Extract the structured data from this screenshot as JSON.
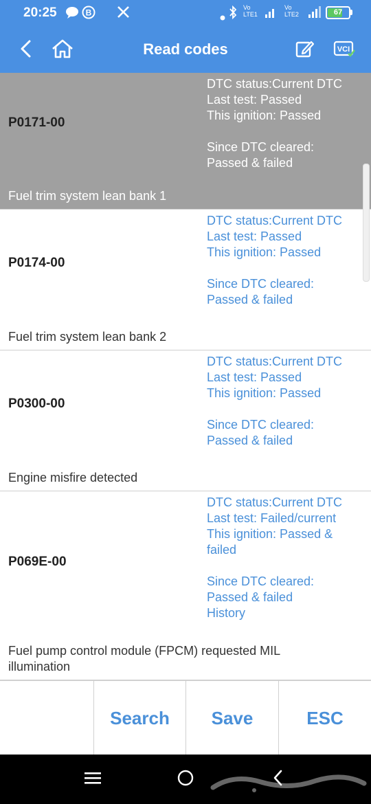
{
  "status_bar": {
    "time": "20:25",
    "notification_icons": [
      "chat-bubble-icon",
      "b-circle-icon",
      "x-icon"
    ],
    "right_icons": [
      "dot-icon",
      "bluetooth-icon",
      "signal-lte1-icon",
      "signal-lte2-icon"
    ],
    "sim1_label": "Vo LTE1",
    "sim2_label": "Vo LTE2",
    "battery_percent": "67",
    "battery_level": 0.67,
    "battery_color": "#5cc861"
  },
  "header": {
    "title": "Read codes",
    "icons": [
      "back-arrow-icon",
      "home-icon",
      "edit-icon",
      "vci-icon"
    ],
    "vci_label": "VCI",
    "background": "#4a90e2"
  },
  "dtcs": [
    {
      "code": "P0171-00",
      "status_lines": [
        "DTC status:Current DTC",
        "Last test: Passed",
        "This ignition: Passed"
      ],
      "since_lines": [
        "Since DTC cleared:",
        "Passed & failed"
      ],
      "description": "Fuel trim system lean bank 1",
      "selected": true
    },
    {
      "code": "P0174-00",
      "status_lines": [
        "DTC status:Current DTC",
        "Last test: Passed",
        "This ignition: Passed"
      ],
      "since_lines": [
        "Since DTC cleared:",
        "Passed & failed"
      ],
      "description": "Fuel trim system lean bank 2",
      "selected": false
    },
    {
      "code": "P0300-00",
      "status_lines": [
        "DTC status:Current DTC",
        "Last test: Passed",
        "This ignition: Passed"
      ],
      "since_lines": [
        "Since DTC cleared:",
        "Passed & failed"
      ],
      "description": "Engine misfire detected",
      "selected": false
    },
    {
      "code": "P069E-00",
      "status_lines": [
        "DTC status:Current DTC",
        "Last test: Failed/current",
        "This ignition: Passed &",
        "failed"
      ],
      "since_lines": [
        "Since DTC cleared:",
        "Passed & failed",
        "History"
      ],
      "description_lines": [
        "Fuel pump control module (FPCM) requested MIL",
        "illumination"
      ],
      "selected": false
    }
  ],
  "toolbar": {
    "search_label": "Search",
    "save_label": "Save",
    "esc_label": "ESC"
  },
  "nav_bar": {
    "icons": [
      "menu-icon",
      "home-circle-icon",
      "back-chevron-icon"
    ]
  },
  "colors": {
    "accent": "#4a90e2",
    "link_text": "#4a90d9",
    "selected_row": "#a0a0a0"
  }
}
